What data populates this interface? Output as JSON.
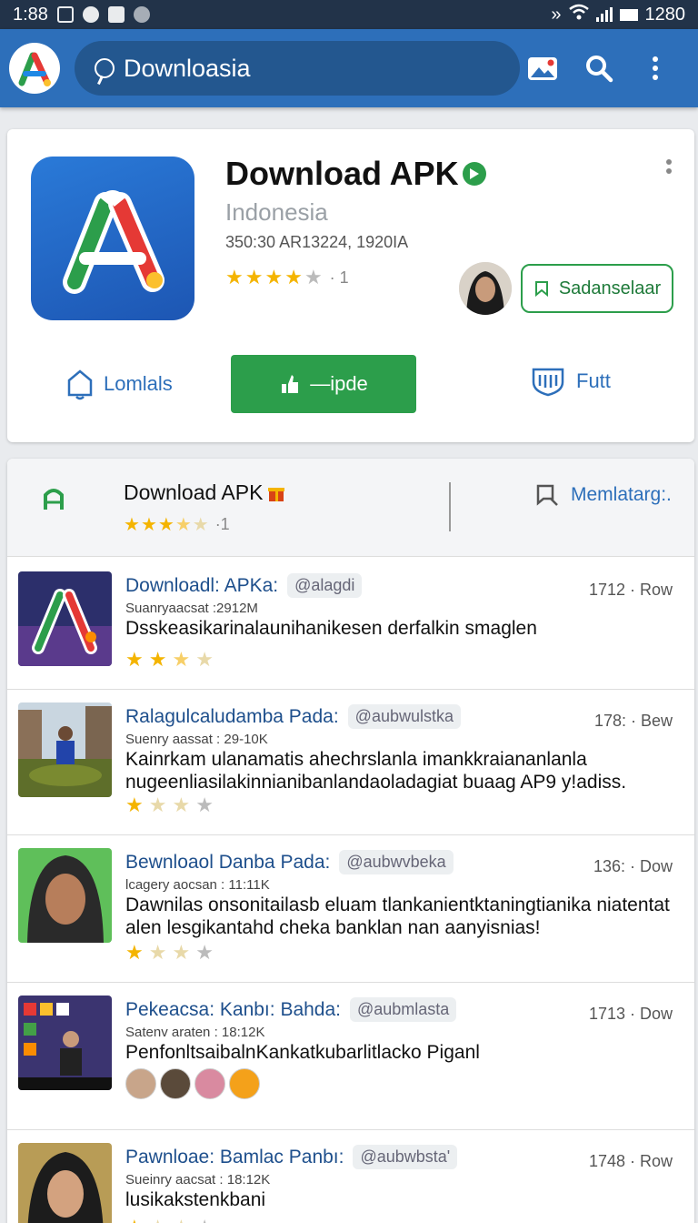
{
  "status_bar": {
    "time": "1:88",
    "right_text": "1280"
  },
  "app_bar": {
    "search_text": "Downloasia"
  },
  "hero": {
    "title": "Download APK",
    "subtitle": "Indonesia",
    "meta": "350:30 AR13224, 1920IA",
    "rating_suffix": "· 1",
    "follow_label": "Sadanselaar",
    "action_left_label": "Lomlals",
    "install_label": "—ipde",
    "action_right_label": "Futt"
  },
  "section": {
    "title": "Download APK",
    "rating_suffix": "·1",
    "action_label": "Memlatarg:."
  },
  "list": [
    {
      "title": "Downloadl: APKa:",
      "tag": "@alagdi",
      "time": "1712 · Row",
      "meta": "Suanryaacsat :2912M",
      "desc": "Dsskeasikarinalaunihanikesen derfalkin smaglen"
    },
    {
      "title": "Ralagulcaludamba Pada:",
      "tag": "@aubwulstka",
      "time": "178: · Bew",
      "meta": "Suenry aassat : 29-10K",
      "desc": "Kainrkam ulanamatis ahechrslanla imankkraiananlanla nugeenliasilakinnianibanlandaoladagiat buaag AP9 y!adiss."
    },
    {
      "title": "Bewnloaol Danba Pada:",
      "tag": "@aubwvbeka",
      "time": "136: · Dow",
      "meta": "lcagery aocsan : 11:11K",
      "desc": "Dawnilas onsonitailasb eluam tlankanientktaningtianika niatentat alen lesgikantahd cheka banklan nan aanyisnias!"
    },
    {
      "title": "Pekeacsa: Kanbı: Bahda:",
      "tag": "@aubmlasta",
      "time": "1713 · Dow",
      "meta": "Satenv araten : 18:12K",
      "desc": "PenfonltsaibalnKankatkubarlitlacko Piganl"
    },
    {
      "title": "Pawnloae: Bamlac Panbı:",
      "tag": "@aubwbsta'",
      "time": "1748 · Row",
      "meta": "Sueinry aacsat : 18:12K",
      "desc": "lusikakstenkbani"
    }
  ]
}
